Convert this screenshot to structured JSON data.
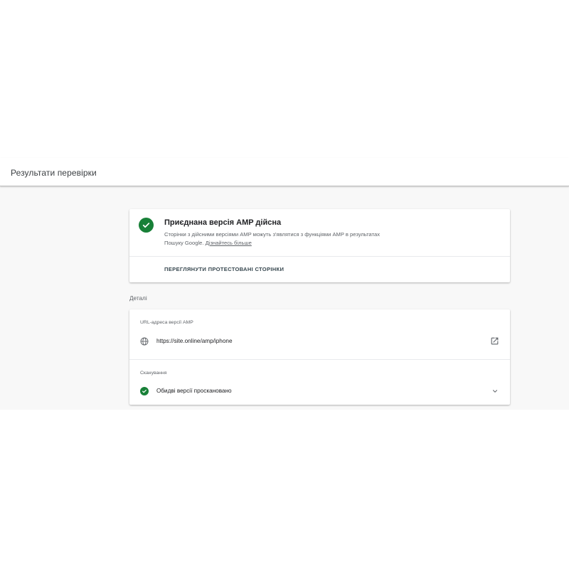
{
  "header": {
    "title": "Результати перевірки"
  },
  "status": {
    "icon": "check-circle-icon",
    "color": "#188038",
    "title": "Приєднана версія AMP дійсна",
    "description": "Сторінки з дійсними версіями AMP можуть з'являтися з функціями AMP в результатах Пошуку Google.",
    "learn_more": "Дізнайтесь більше",
    "action_label": "ПЕРЕГЛЯНУТИ ПРОТЕСТОВАНІ СТОРІНКИ"
  },
  "details": {
    "label": "Деталі",
    "url_section": {
      "label": "URL-адреса версії AMP",
      "icon": "globe-icon",
      "value": "https://site.online/amp/iphone",
      "action_icon": "open-in-new-icon"
    },
    "crawl_section": {
      "label": "Сканування",
      "icon": "check-circle-icon",
      "value": "Обидві версії проскановано",
      "expand_icon": "chevron-down-icon"
    }
  }
}
